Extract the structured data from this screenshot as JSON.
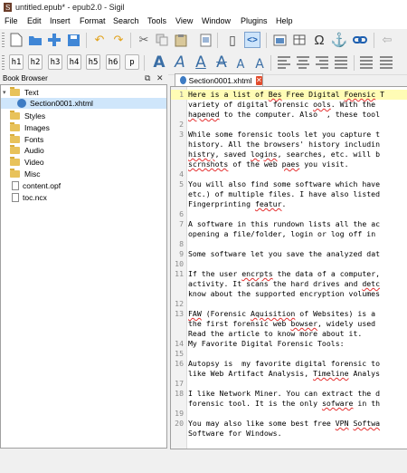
{
  "window": {
    "title": "untitled.epub* - epub2.0 - Sigil",
    "app_icon": "sigil-icon"
  },
  "menu": [
    "File",
    "Edit",
    "Insert",
    "Format",
    "Search",
    "Tools",
    "View",
    "Window",
    "Plugins",
    "Help"
  ],
  "toolbar1": [
    "new-file-icon",
    "open-folder-icon",
    "add-file-icon",
    "save-icon",
    "undo-icon",
    "redo-icon",
    "cut-icon",
    "copy-icon",
    "paste-icon",
    "check-icon",
    "book-view-icon",
    "code-view-icon",
    "insert-image-icon",
    "table-icon",
    "omega-icon",
    "anchor-icon",
    "link-icon",
    "back-icon"
  ],
  "heading_buttons": [
    "h1",
    "h2",
    "h3",
    "h4",
    "h5",
    "h6",
    "p"
  ],
  "format_buttons": [
    "A",
    "A",
    "A",
    "A",
    "A",
    "A"
  ],
  "book_browser": {
    "title": "Book Browser",
    "float_icon": "⧉",
    "close_icon": "✕",
    "items": [
      {
        "label": "Text",
        "type": "folder",
        "expanded": true,
        "level": 0
      },
      {
        "label": "Section0001.xhtml",
        "type": "xhtml",
        "level": 1,
        "selected": true
      },
      {
        "label": "Styles",
        "type": "folder",
        "level": 0
      },
      {
        "label": "Images",
        "type": "folder",
        "level": 0
      },
      {
        "label": "Fonts",
        "type": "folder",
        "level": 0
      },
      {
        "label": "Audio",
        "type": "folder",
        "level": 0
      },
      {
        "label": "Video",
        "type": "folder",
        "level": 0
      },
      {
        "label": "Misc",
        "type": "folder",
        "level": 0
      },
      {
        "label": "content.opf",
        "type": "file",
        "level": 0
      },
      {
        "label": "toc.ncx",
        "type": "file",
        "level": 0
      }
    ]
  },
  "tab": {
    "label": "Section0001.xhtml",
    "close_icon": "✕"
  },
  "editor": {
    "lines": [
      {
        "n": "1",
        "text": "Here is a list of Bes Free Digital Foensic T",
        "highlight": true
      },
      {
        "n": "",
        "text": "variety of digital forensic ools. With the "
      },
      {
        "n": "",
        "text": "hapened to the computer. Also  , these tool"
      },
      {
        "n": "2",
        "text": ""
      },
      {
        "n": "3",
        "text": "While some forensic tools let you capture t"
      },
      {
        "n": "",
        "text": "history. All the browsers' history includin"
      },
      {
        "n": "",
        "text": "histry, saved logins, searches, etc. will b"
      },
      {
        "n": "",
        "text": "scrnshots of the web paes you visit."
      },
      {
        "n": "4",
        "text": ""
      },
      {
        "n": "5",
        "text": "You will also find some software which have"
      },
      {
        "n": "",
        "text": "etc.) of multiple files. I have also listed"
      },
      {
        "n": "",
        "text": "Fingerprinting featur."
      },
      {
        "n": "6",
        "text": ""
      },
      {
        "n": "7",
        "text": "A software in this rundown lists all the ac"
      },
      {
        "n": "",
        "text": "opening a file/folder, login or log off in"
      },
      {
        "n": "8",
        "text": ""
      },
      {
        "n": "9",
        "text": "Some software let you save the analyzed dat"
      },
      {
        "n": "10",
        "text": ""
      },
      {
        "n": "11",
        "text": "If the user encrpts the data of a computer,"
      },
      {
        "n": "",
        "text": "activity. It scans the hard drives and detc"
      },
      {
        "n": "",
        "text": "know about the supported encryption volumes"
      },
      {
        "n": "12",
        "text": ""
      },
      {
        "n": "13",
        "text": "FAW (Forensic Aquisition of Websites) is a"
      },
      {
        "n": "",
        "text": "the first forensic web bowser, widely used"
      },
      {
        "n": "",
        "text": "Read the article to know more about it."
      },
      {
        "n": "14",
        "text": "My Favorite Digital Forensic Tools:"
      },
      {
        "n": "15",
        "text": ""
      },
      {
        "n": "16",
        "text": "Autopsy is  my favorite digital forensic to"
      },
      {
        "n": "",
        "text": "like Web Artifact Analysis, Timeline Analys"
      },
      {
        "n": "17",
        "text": ""
      },
      {
        "n": "18",
        "text": "I like Network Miner. You can extract the d"
      },
      {
        "n": "",
        "text": "forensic tool. It is the only sofware in th"
      },
      {
        "n": "19",
        "text": ""
      },
      {
        "n": "20",
        "text": "You may also like some best free VPN Softwa"
      },
      {
        "n": "",
        "text": "Software for Windows."
      }
    ]
  },
  "colors": {
    "highlight_line": "#fffcb5",
    "spell_underline": "#e53030",
    "folder": "#e8c25a",
    "selection": "#cfe6fb",
    "tab_close": "#e24b2b"
  }
}
